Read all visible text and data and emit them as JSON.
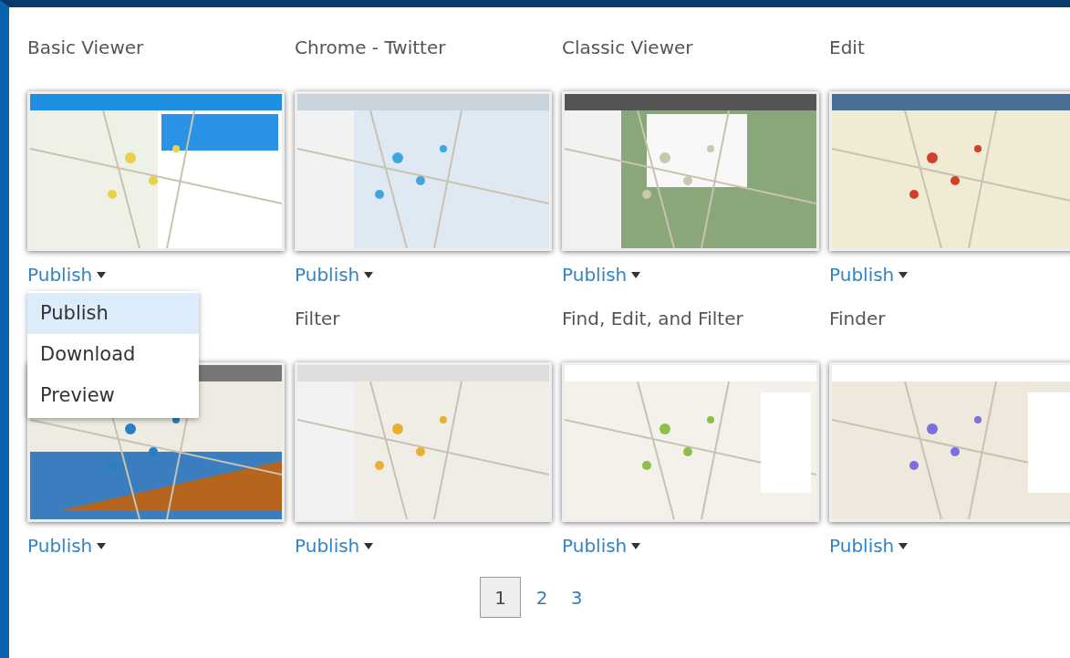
{
  "templates": [
    {
      "title": "Basic Viewer",
      "action": "Publish",
      "menu": [
        {
          "label": "Publish",
          "selected": true
        },
        {
          "label": "Download",
          "selected": false
        },
        {
          "label": "Preview",
          "selected": false
        }
      ]
    },
    {
      "title": "Chrome - Twitter",
      "action": "Publish"
    },
    {
      "title": "Classic Viewer",
      "action": "Publish"
    },
    {
      "title": "Edit",
      "action": "Publish"
    },
    {
      "action": "Publish"
    },
    {
      "title": "Filter",
      "action": "Publish"
    },
    {
      "title": "Find, Edit, and Filter",
      "action": "Publish"
    },
    {
      "title": "Finder",
      "action": "Publish"
    }
  ],
  "pagination": [
    {
      "label": "1",
      "selected": true
    },
    {
      "label": "2",
      "selected": false
    },
    {
      "label": "3",
      "selected": false
    }
  ]
}
